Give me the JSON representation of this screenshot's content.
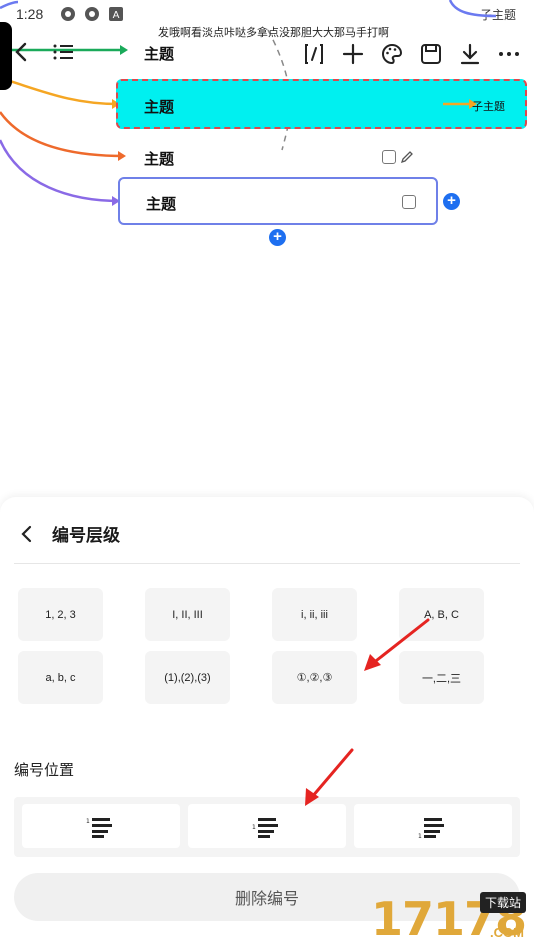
{
  "status_bar": {
    "time": "1:28",
    "right_text": "子主题"
  },
  "banner_text": "发哦啊看淡点咔哒多拿点没那胆大大那马手打啊",
  "mindmap": {
    "nodes": [
      {
        "label": "主题"
      },
      {
        "label": "主题",
        "sublabel": "子主题"
      },
      {
        "label": "主题"
      },
      {
        "label": "主题"
      }
    ]
  },
  "toolbar": {
    "icons": [
      "format-brush-icon",
      "add-icon",
      "palette-icon",
      "save-icon",
      "download-icon",
      "more-icon"
    ]
  },
  "sheet": {
    "title": "编号层级",
    "number_options": [
      "1, 2, 3",
      "I, II, III",
      "i, ii, iii",
      "A, B, C",
      "a, b, c",
      "(1),(2),(3)",
      "①,②,③",
      "一,二,三"
    ],
    "position_label": "编号位置",
    "delete_label": "删除编号"
  },
  "watermark": {
    "number": "17178",
    "tag": "下载站",
    "suffix": ".COM"
  },
  "colors": {
    "selected_fill": "#00f0f0",
    "selected_border": "#e0474c",
    "accent_blue": "#1e6ff0",
    "annotation_red": "#e52421"
  }
}
